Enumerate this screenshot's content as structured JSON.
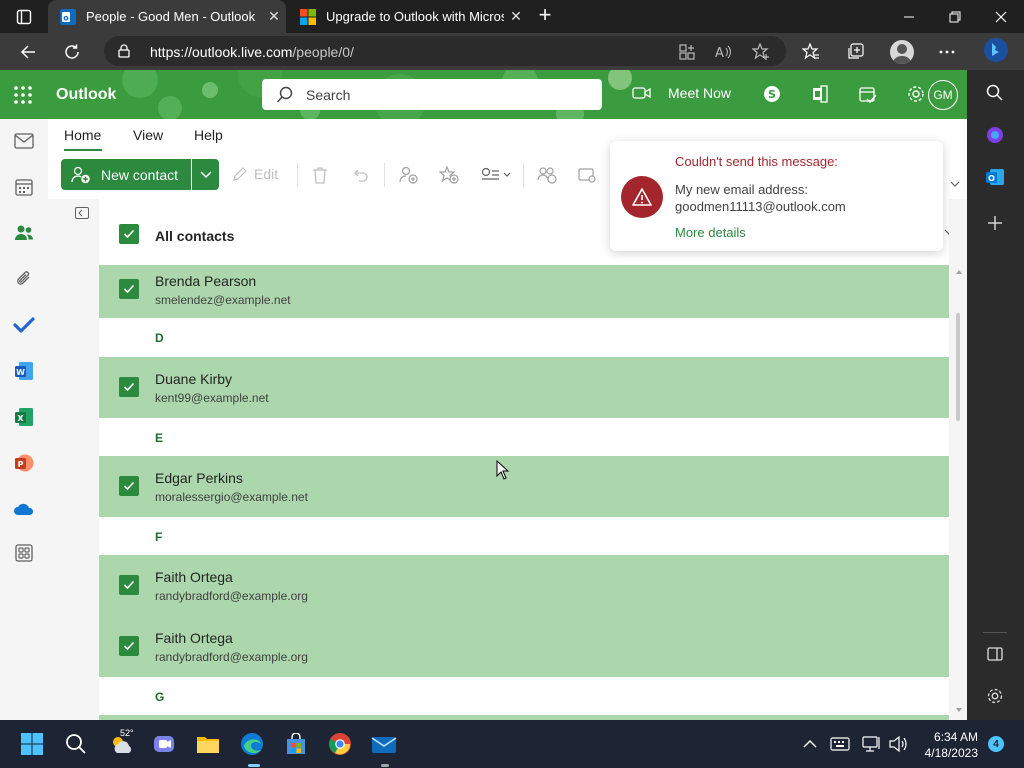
{
  "browser": {
    "tabs": [
      {
        "title": "People - Good Men - Outlook",
        "active": true
      },
      {
        "title": "Upgrade to Outlook with Microsoft",
        "active": false
      }
    ],
    "url": {
      "host": "https://outlook.live.com",
      "path": "/people/0/"
    },
    "close_glyph": "✕",
    "new_tab_glyph": "+"
  },
  "outlook": {
    "brand": "Outlook",
    "search_placeholder": "Search",
    "meet_now": "Meet Now",
    "avatar_initials": "GM",
    "accent_color": "#2b8a3e"
  },
  "ribbon": {
    "tabs": [
      "Home",
      "View",
      "Help"
    ],
    "new_contact": "New contact",
    "edit": "Edit"
  },
  "contacts": {
    "all_label": "All contacts",
    "rows": [
      {
        "type": "contact",
        "name": "Brenda Pearson",
        "email": "smelendez@example.net",
        "checked": true
      },
      {
        "type": "header",
        "letter": "D"
      },
      {
        "type": "contact",
        "name": "Duane Kirby",
        "email": "kent99@example.net",
        "checked": true
      },
      {
        "type": "header",
        "letter": "E"
      },
      {
        "type": "contact",
        "name": "Edgar Perkins",
        "email": "moralessergio@example.net",
        "checked": true
      },
      {
        "type": "header",
        "letter": "F"
      },
      {
        "type": "contact",
        "name": "Faith Ortega",
        "email": "randybradford@example.org",
        "checked": true
      },
      {
        "type": "contact",
        "name": "Faith Ortega",
        "email": "randybradford@example.org",
        "checked": true
      },
      {
        "type": "header",
        "letter": "G"
      }
    ]
  },
  "toast": {
    "title": "Couldn't send this message:",
    "message_line1": "My new email address:",
    "message_line2": "goodmen11113@outlook.com",
    "link": "More details"
  },
  "taskbar": {
    "weather_temp": "52°",
    "time": "6:34 AM",
    "date": "4/18/2023",
    "notifications": "4"
  }
}
